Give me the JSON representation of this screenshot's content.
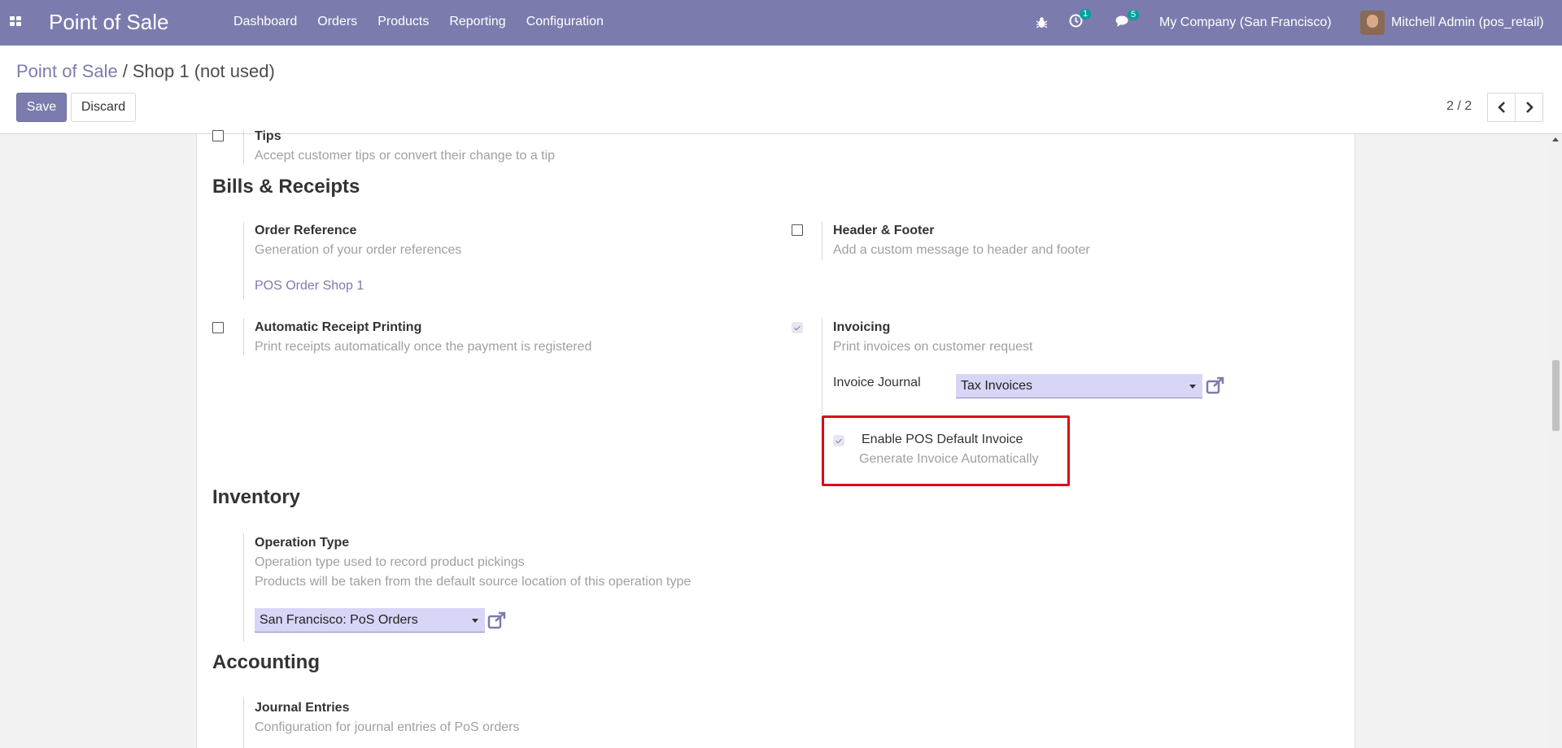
{
  "navbar": {
    "brand": "Point of Sale",
    "menu": [
      "Dashboard",
      "Orders",
      "Products",
      "Reporting",
      "Configuration"
    ],
    "activity_count": "1",
    "messages_count": "5",
    "company": "My Company (San Francisco)",
    "user": "Mitchell Admin (pos_retail)",
    "bg_color": "#7c7bad"
  },
  "breadcrumb": {
    "parent": "Point of Sale",
    "separator": "/",
    "current": "Shop 1 (not used)"
  },
  "buttons": {
    "save": "Save",
    "discard": "Discard"
  },
  "pager": {
    "value": "2 / 2"
  },
  "tips": {
    "title": "Tips",
    "desc": "Accept customer tips or convert their change to a tip",
    "checked": false
  },
  "bills": {
    "heading": "Bills & Receipts",
    "order_reference": {
      "title": "Order Reference",
      "desc": "Generation of your order references",
      "link": "POS Order Shop 1"
    },
    "header_footer": {
      "title": "Header & Footer",
      "desc": "Add a custom message to header and footer",
      "checked": false
    },
    "auto_receipt": {
      "title": "Automatic Receipt Printing",
      "desc": "Print receipts automatically once the payment is registered",
      "checked": false
    },
    "invoicing": {
      "title": "Invoicing",
      "desc": "Print invoices on customer request",
      "checked": true,
      "journal_label": "Invoice Journal",
      "journal_value": "Tax Invoices"
    },
    "default_invoice": {
      "title": "Enable POS Default Invoice",
      "desc": "Generate Invoice Automatically",
      "checked": true
    }
  },
  "inventory": {
    "heading": "Inventory",
    "operation_type": {
      "title": "Operation Type",
      "desc1": "Operation type used to record product pickings",
      "desc2": "Products will be taken from the default source location of this operation type",
      "value": "San Francisco: PoS Orders"
    }
  },
  "accounting": {
    "heading": "Accounting",
    "journal_entries": {
      "title": "Journal Entries",
      "desc": "Configuration for journal entries of PoS orders"
    }
  }
}
